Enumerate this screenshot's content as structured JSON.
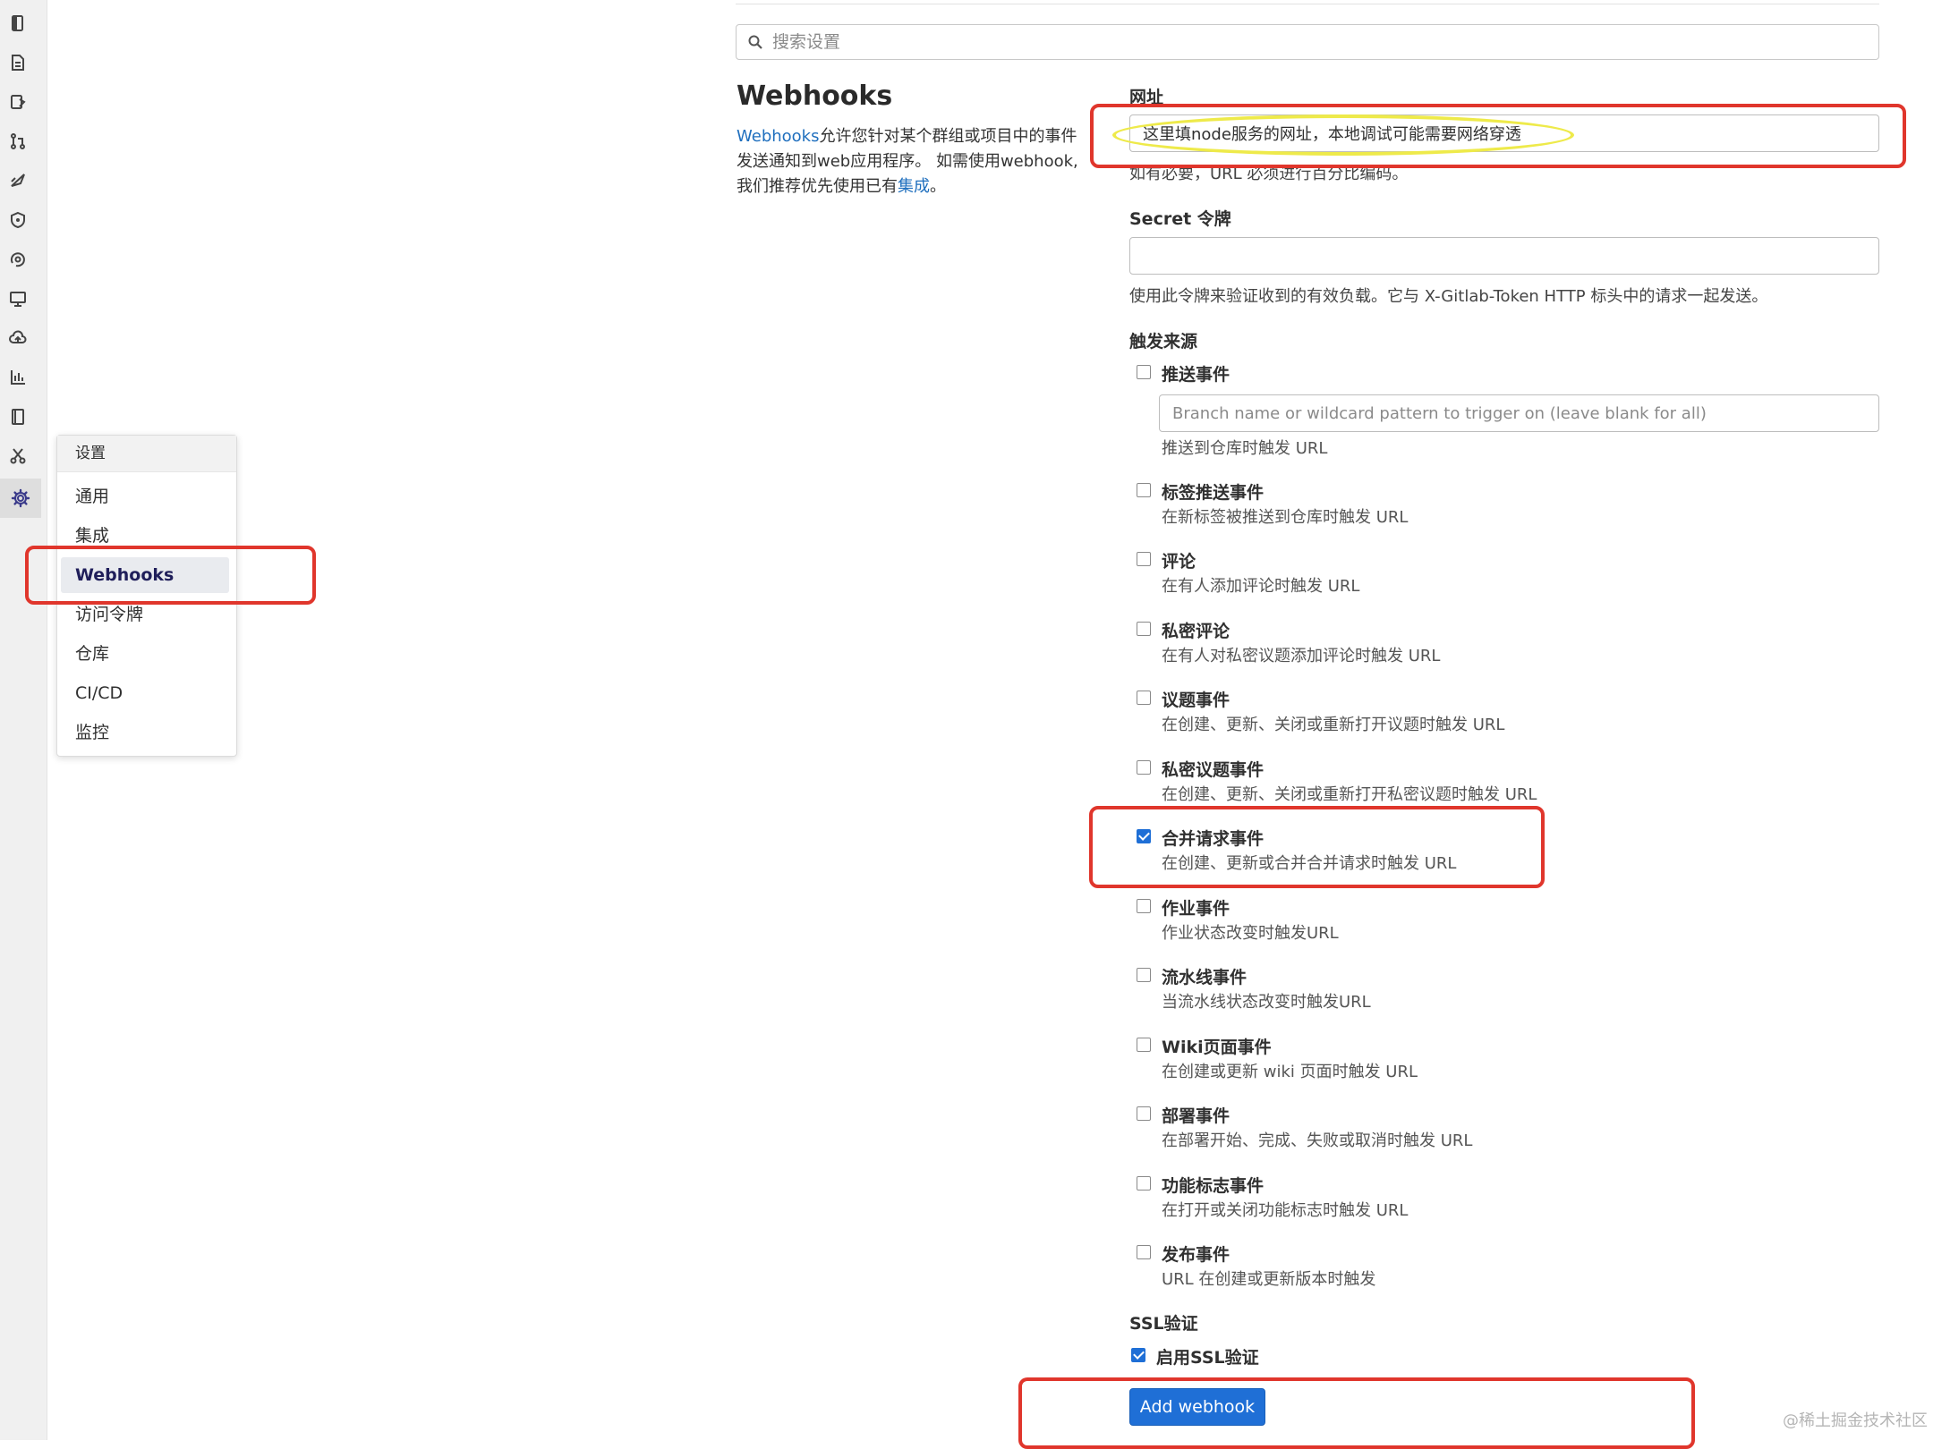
{
  "rail": {
    "icons": [
      "project-overview-icon",
      "repository-icon",
      "issues-icon",
      "merge-request-icon",
      "ci-cd-icon",
      "security-icon",
      "deployments-icon",
      "monitor-icon",
      "infrastructure-icon",
      "analytics-icon",
      "wiki-icon",
      "snippets-icon",
      "settings-icon"
    ]
  },
  "flyout": {
    "header": "设置",
    "items": [
      "通用",
      "集成",
      "Webhooks",
      "访问令牌",
      "仓库",
      "CI/CD",
      "监控"
    ],
    "active": "Webhooks"
  },
  "search": {
    "placeholder": "搜索设置"
  },
  "section": {
    "title": "Webhooks",
    "desc_link": "Webhooks",
    "desc_1": "允许您针对某个群组或项目中的事件发送通知到web应用程序。 如需使用webhook,我们推荐优先使用已有",
    "desc_link2": "集成",
    "desc_end": "。"
  },
  "url_field": {
    "label": "网址",
    "value": "这里填node服务的网址，本地调试可能需要网络穿透",
    "help": "如有必要，URL 必须进行百分比编码。"
  },
  "secret_field": {
    "label": "Secret 令牌",
    "value": "",
    "help": "使用此令牌来验证收到的有效负载。它与 X-Gitlab-Token HTTP 标头中的请求一起发送。"
  },
  "triggers": {
    "label": "触发来源",
    "push": {
      "title": "推送事件",
      "checked": false,
      "branch_placeholder": "Branch name or wildcard pattern to trigger on (leave blank for all)",
      "desc": "推送到仓库时触发 URL"
    },
    "events": [
      {
        "title": "标签推送事件",
        "desc": "在新标签被推送到仓库时触发 URL",
        "checked": false
      },
      {
        "title": "评论",
        "desc": "在有人添加评论时触发 URL",
        "checked": false
      },
      {
        "title": "私密评论",
        "desc": "在有人对私密议题添加评论时触发 URL",
        "checked": false
      },
      {
        "title": "议题事件",
        "desc": "在创建、更新、关闭或重新打开议题时触发 URL",
        "checked": false
      },
      {
        "title": "私密议题事件",
        "desc": "在创建、更新、关闭或重新打开私密议题时触发 URL",
        "checked": false
      },
      {
        "title": "合并请求事件",
        "desc": "在创建、更新或合并合并请求时触发 URL",
        "checked": true
      },
      {
        "title": "作业事件",
        "desc": "作业状态改变时触发URL",
        "checked": false
      },
      {
        "title": "流水线事件",
        "desc": "当流水线状态改变时触发URL",
        "checked": false
      },
      {
        "title": "Wiki页面事件",
        "desc": "在创建或更新 wiki 页面时触发 URL",
        "checked": false
      },
      {
        "title": "部署事件",
        "desc": "在部署开始、完成、失败或取消时触发 URL",
        "checked": false
      },
      {
        "title": "功能标志事件",
        "desc": "在打开或关闭功能标志时触发 URL",
        "checked": false
      },
      {
        "title": "发布事件",
        "desc": "URL 在创建或更新版本时触发",
        "checked": false
      }
    ]
  },
  "ssl": {
    "label": "SSL验证",
    "checkbox_label": "启用SSL验证",
    "checked": true
  },
  "submit": {
    "label": "Add webhook"
  },
  "watermark": "@稀土掘金技术社区",
  "colors": {
    "primary": "#1f6fd6",
    "annotation_red": "#e0362c",
    "annotation_yellow": "#eeea4a"
  }
}
